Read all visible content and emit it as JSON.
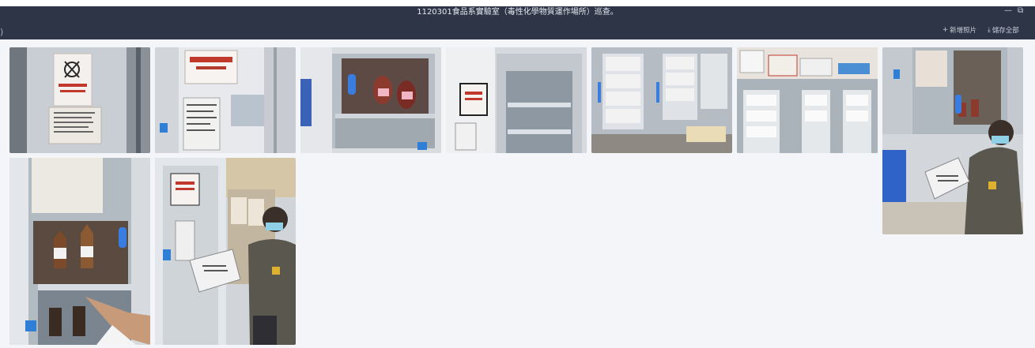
{
  "window": {
    "title": "1120301食品系實驗室（毒性化學物質運作場所）巡查。",
    "minimize_icon": "minimize-icon",
    "maximize_icon": "maximize-icon"
  },
  "toolbar": {
    "add_icon": "plus-icon",
    "add_label": "新增照片",
    "save_icon": "download-icon",
    "save_label": "儲存全部"
  },
  "gallery": {
    "photos": [
      {
        "id": 1,
        "scene": "hazard-poster-door",
        "sign_text": "毒性化學物質運作場所"
      },
      {
        "id": 2,
        "scene": "cabinet-label",
        "sign_text": "毒性化學物質"
      },
      {
        "id": 3,
        "scene": "cabinet-bottles"
      },
      {
        "id": 4,
        "scene": "cabinet-doors"
      },
      {
        "id": 5,
        "scene": "cabinet-papers"
      },
      {
        "id": 6,
        "scene": "cabinet-papers-wide"
      },
      {
        "id": 7,
        "scene": "inspector-kneeling"
      },
      {
        "id": 8,
        "scene": "bottles-pointing"
      },
      {
        "id": 9,
        "scene": "inspector-reading"
      }
    ]
  }
}
